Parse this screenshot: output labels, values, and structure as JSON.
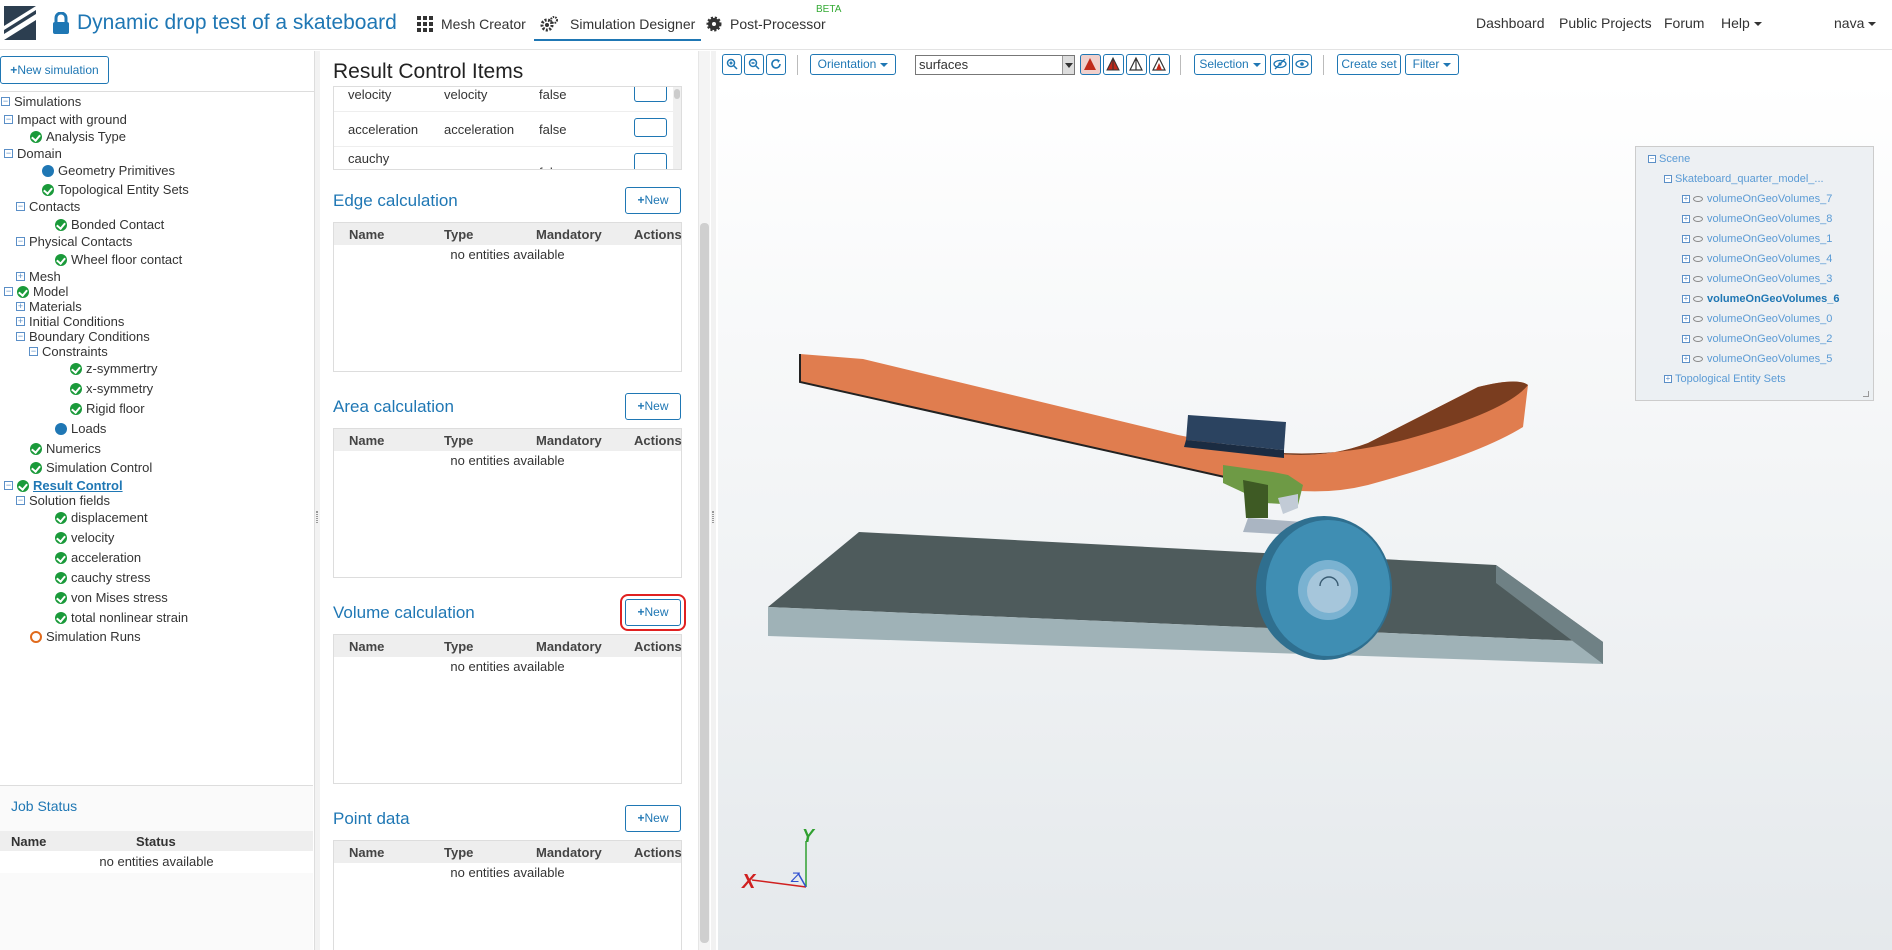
{
  "header": {
    "title": "Dynamic drop test of a skateboard",
    "nav": [
      {
        "label": "Mesh Creator",
        "icon": "grid-icon"
      },
      {
        "label": "Simulation Designer",
        "icon": "gears-icon"
      },
      {
        "label": "Post-Processor",
        "icon": "cog-icon",
        "badge": "BETA"
      }
    ],
    "right_nav": {
      "dashboard": "Dashboard",
      "public_projects": "Public Projects",
      "forum": "Forum",
      "help": "Help",
      "user": "nava"
    }
  },
  "left_panel": {
    "new_simulation": "New simulation",
    "tree": [
      {
        "label": "Simulations",
        "status": "none",
        "expander": "−"
      },
      {
        "label": "Impact with ground",
        "status": "none",
        "expander": "−"
      },
      {
        "label": "Analysis Type",
        "status": "ok"
      },
      {
        "label": "Domain",
        "status": "none",
        "expander": "−"
      },
      {
        "label": "Geometry Primitives",
        "status": "info"
      },
      {
        "label": "Topological Entity Sets",
        "status": "ok"
      },
      {
        "label": "Contacts",
        "status": "none",
        "expander": "−"
      },
      {
        "label": "Bonded Contact",
        "status": "ok"
      },
      {
        "label": "Physical Contacts",
        "status": "none",
        "expander": "−"
      },
      {
        "label": "Wheel floor contact",
        "status": "ok"
      },
      {
        "label": "Mesh",
        "status": "none",
        "expander": "+"
      },
      {
        "label": "Model",
        "status": "ok",
        "expander": "−"
      },
      {
        "label": "Materials",
        "status": "none",
        "expander": "+"
      },
      {
        "label": "Initial Conditions",
        "status": "none",
        "expander": "+"
      },
      {
        "label": "Boundary Conditions",
        "status": "none",
        "expander": "−"
      },
      {
        "label": "Constraints",
        "status": "none",
        "expander": "−"
      },
      {
        "label": "z-symmertry",
        "status": "ok"
      },
      {
        "label": "x-symmetry",
        "status": "ok"
      },
      {
        "label": "Rigid floor",
        "status": "ok"
      },
      {
        "label": "Loads",
        "status": "info"
      },
      {
        "label": "Numerics",
        "status": "ok"
      },
      {
        "label": "Simulation Control",
        "status": "ok"
      },
      {
        "label": "Result Control",
        "status": "ok",
        "expander": "−",
        "selected": true
      },
      {
        "label": "Solution fields",
        "status": "none",
        "expander": "−"
      },
      {
        "label": "displacement",
        "status": "ok"
      },
      {
        "label": "velocity",
        "status": "ok"
      },
      {
        "label": "acceleration",
        "status": "ok"
      },
      {
        "label": "cauchy stress",
        "status": "ok"
      },
      {
        "label": "von Mises stress",
        "status": "ok"
      },
      {
        "label": "total nonlinear strain",
        "status": "ok"
      },
      {
        "label": "Simulation Runs",
        "status": "pending"
      }
    ],
    "job_status": {
      "title": "Job Status",
      "columns": [
        "Name",
        "Status"
      ],
      "empty": "no entities available"
    }
  },
  "middle_panel": {
    "title": "Result Control Items",
    "top_rows": [
      [
        "velocity",
        "velocity",
        "false"
      ],
      [
        "acceleration",
        "acceleration",
        "false"
      ],
      [
        "cauchy",
        "",
        "false"
      ]
    ],
    "sections": [
      {
        "title": "Edge calculation",
        "new": "New"
      },
      {
        "title": "Area calculation",
        "new": "New"
      },
      {
        "title": "Volume calculation",
        "new": "New"
      },
      {
        "title": "Point data",
        "new": "New"
      }
    ],
    "columns": [
      "Name",
      "Type",
      "Mandatory",
      "Actions"
    ],
    "empty": "no entities available"
  },
  "viewer": {
    "orientation": "Orientation",
    "render_mode": "surfaces",
    "selection": "Selection",
    "create_set": "Create set",
    "filter": "Filter",
    "scene": {
      "root": "Scene",
      "model": "Skateboard_quarter_model_...",
      "volumes": [
        "volumeOnGeoVolumes_7",
        "volumeOnGeoVolumes_8",
        "volumeOnGeoVolumes_1",
        "volumeOnGeoVolumes_4",
        "volumeOnGeoVolumes_3",
        "volumeOnGeoVolumes_6",
        "volumeOnGeoVolumes_0",
        "volumeOnGeoVolumes_2",
        "volumeOnGeoVolumes_5"
      ],
      "highlighted": "volumeOnGeoVolumes_6",
      "sets": "Topological Entity Sets"
    },
    "axes": {
      "x": "X",
      "y": "Y",
      "z": "Z"
    }
  },
  "colors": {
    "accent": "#1f77b4",
    "ok": "#1a9a3a",
    "deck": "#e07d4f",
    "floor": "#4e5b5c",
    "wheel": "#3f8eb3",
    "highlight_box": "#e02020"
  }
}
